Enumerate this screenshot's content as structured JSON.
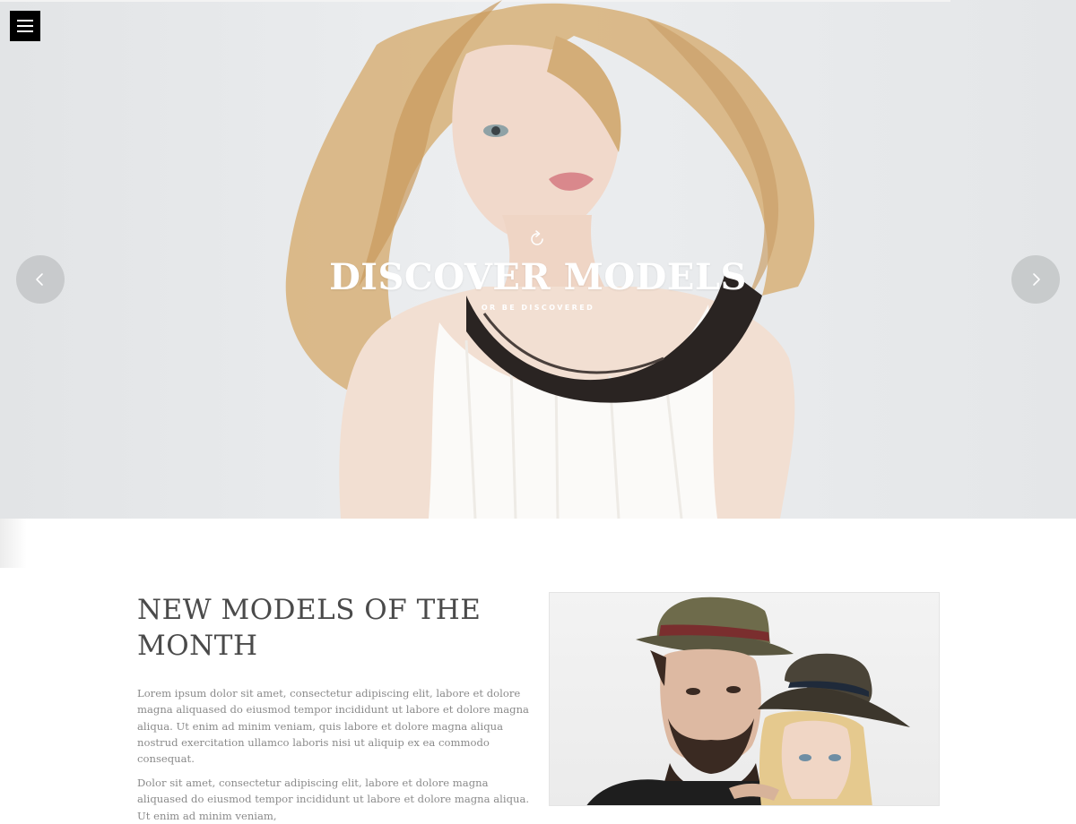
{
  "hero": {
    "title": "DISCOVER MODELS",
    "subtitle": "OR BE DISCOVERED",
    "icons": {
      "menu": "hamburger-menu-icon",
      "reload": "reload-icon",
      "prev": "chevron-left-icon",
      "next": "chevron-right-icon"
    }
  },
  "section": {
    "title": "NEW MODELS OF THE MONTH",
    "paragraphs": [
      "Lorem ipsum dolor sit amet, consectetur adipiscing elit, labore et dolore magna aliquased do eiusmod tempor incididunt ut labore et dolore magna aliqua. Ut enim ad minim veniam, quis labore et dolore magna aliqua nostrud exercitation ullamco laboris nisi ut aliquip ex ea commodo consequat.",
      "Dolor sit amet, consectetur adipiscing elit, labore et dolore magna aliquased do eiusmod tempor incididunt ut labore et dolore magna aliqua. Ut enim ad minim veniam,"
    ]
  },
  "colors": {
    "hero_background": "#e6e8ea",
    "menu_button": "#000000",
    "heading_text": "#4a4a4a",
    "body_text": "#8a8a8a"
  }
}
